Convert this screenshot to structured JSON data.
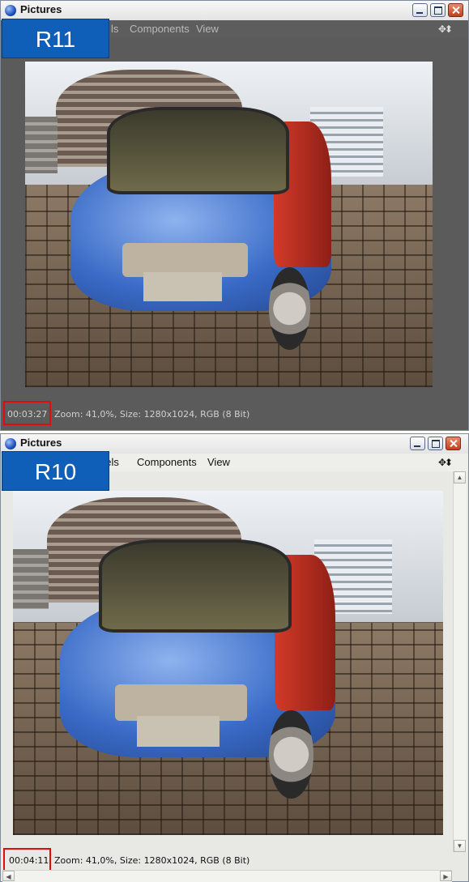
{
  "windows": [
    {
      "title": "Pictures",
      "label": "R11",
      "menu_partial": "ls",
      "menu_components": "Components",
      "menu_view": "View",
      "status_time": "00:03:27",
      "status_info": "Zoom: 41,0%, Size: 1280x1024, RGB (8 Bit)"
    },
    {
      "title": "Pictures",
      "label": "R10",
      "menu_partial": "nels",
      "menu_components": "Components",
      "menu_view": "View",
      "status_time": "00:04:11",
      "status_info": "Zoom: 41,0%, Size: 1280x1024, RGB (8 Bit)"
    }
  ],
  "icons": {
    "app": "cinema4d-app-icon",
    "nav": "move-arrows-icon"
  },
  "colors": {
    "label_bg": "#0f5fb8",
    "highlight_border": "#e10b0b",
    "dark_canvas": "#5b5b5b",
    "light_canvas": "#e8e8e4"
  }
}
